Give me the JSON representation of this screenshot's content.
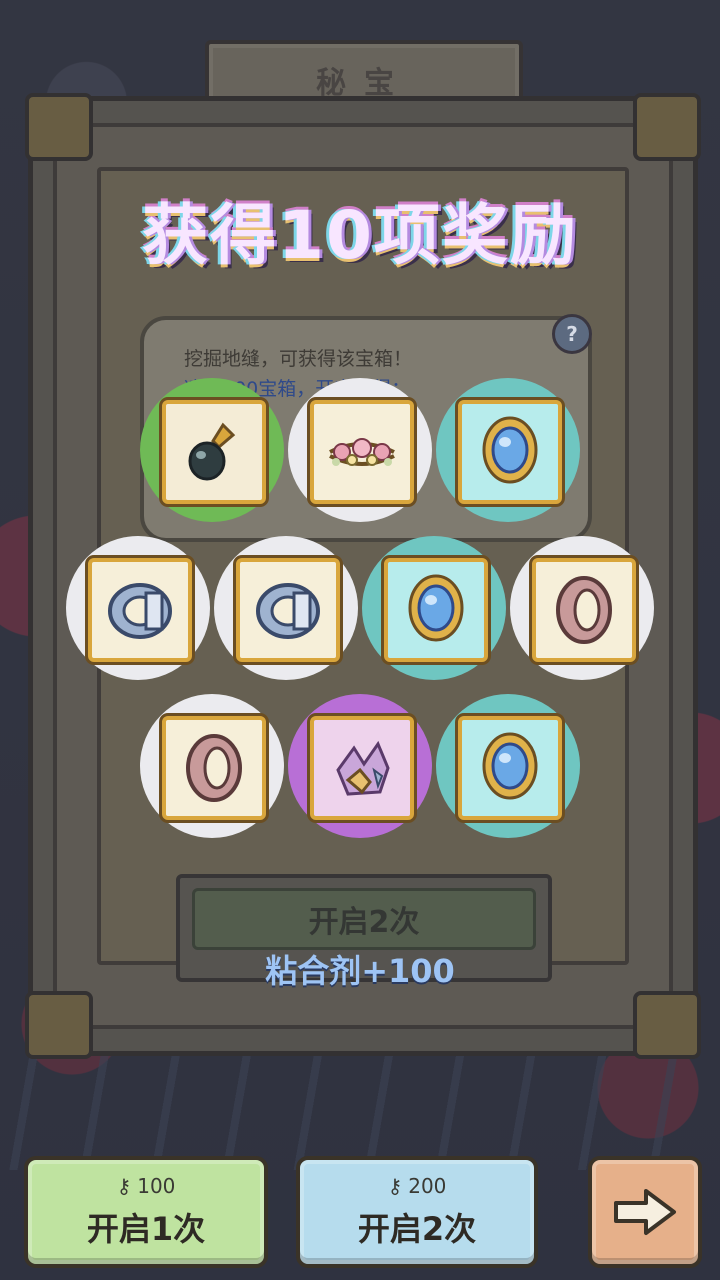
{
  "header": {
    "title": "秘宝"
  },
  "overlay": {
    "title": "获得10项奖励"
  },
  "tooltip": {
    "line1": "挖掘地缝，可获得该宝箱！",
    "line2": "凑齐100宝箱，开宝获得："
  },
  "rewards": [
    {
      "item": "black-pearl-pendant-icon",
      "rarity": "green"
    },
    {
      "item": "flower-crown-icon",
      "rarity": "white"
    },
    {
      "item": "sapphire-brooch-icon",
      "rarity": "teal"
    },
    {
      "item": "silver-ring-icon",
      "rarity": "white"
    },
    {
      "item": "silver-ring-icon",
      "rarity": "white"
    },
    {
      "item": "sapphire-brooch-icon",
      "rarity": "teal"
    },
    {
      "item": "stone-ring-icon",
      "rarity": "white"
    },
    {
      "item": "stone-ring-icon",
      "rarity": "white"
    },
    {
      "item": "crystal-cluster-icon",
      "rarity": "purple"
    },
    {
      "item": "sapphire-brooch-icon",
      "rarity": "teal"
    }
  ],
  "panel": {
    "open_twice_label": "开启2次",
    "glue_text": "粘合剂+100"
  },
  "actions": {
    "open_once": {
      "cost": "100",
      "label": "开启1次"
    },
    "open_twice": {
      "cost": "200",
      "label": "开启2次"
    },
    "next": {
      "icon": "arrow-right-icon"
    }
  },
  "colors": {
    "green": "#6fba56",
    "white": "#ebebef",
    "teal": "#6fc6c1",
    "purple": "#b86fd6",
    "glue": "#9ec4f4"
  }
}
